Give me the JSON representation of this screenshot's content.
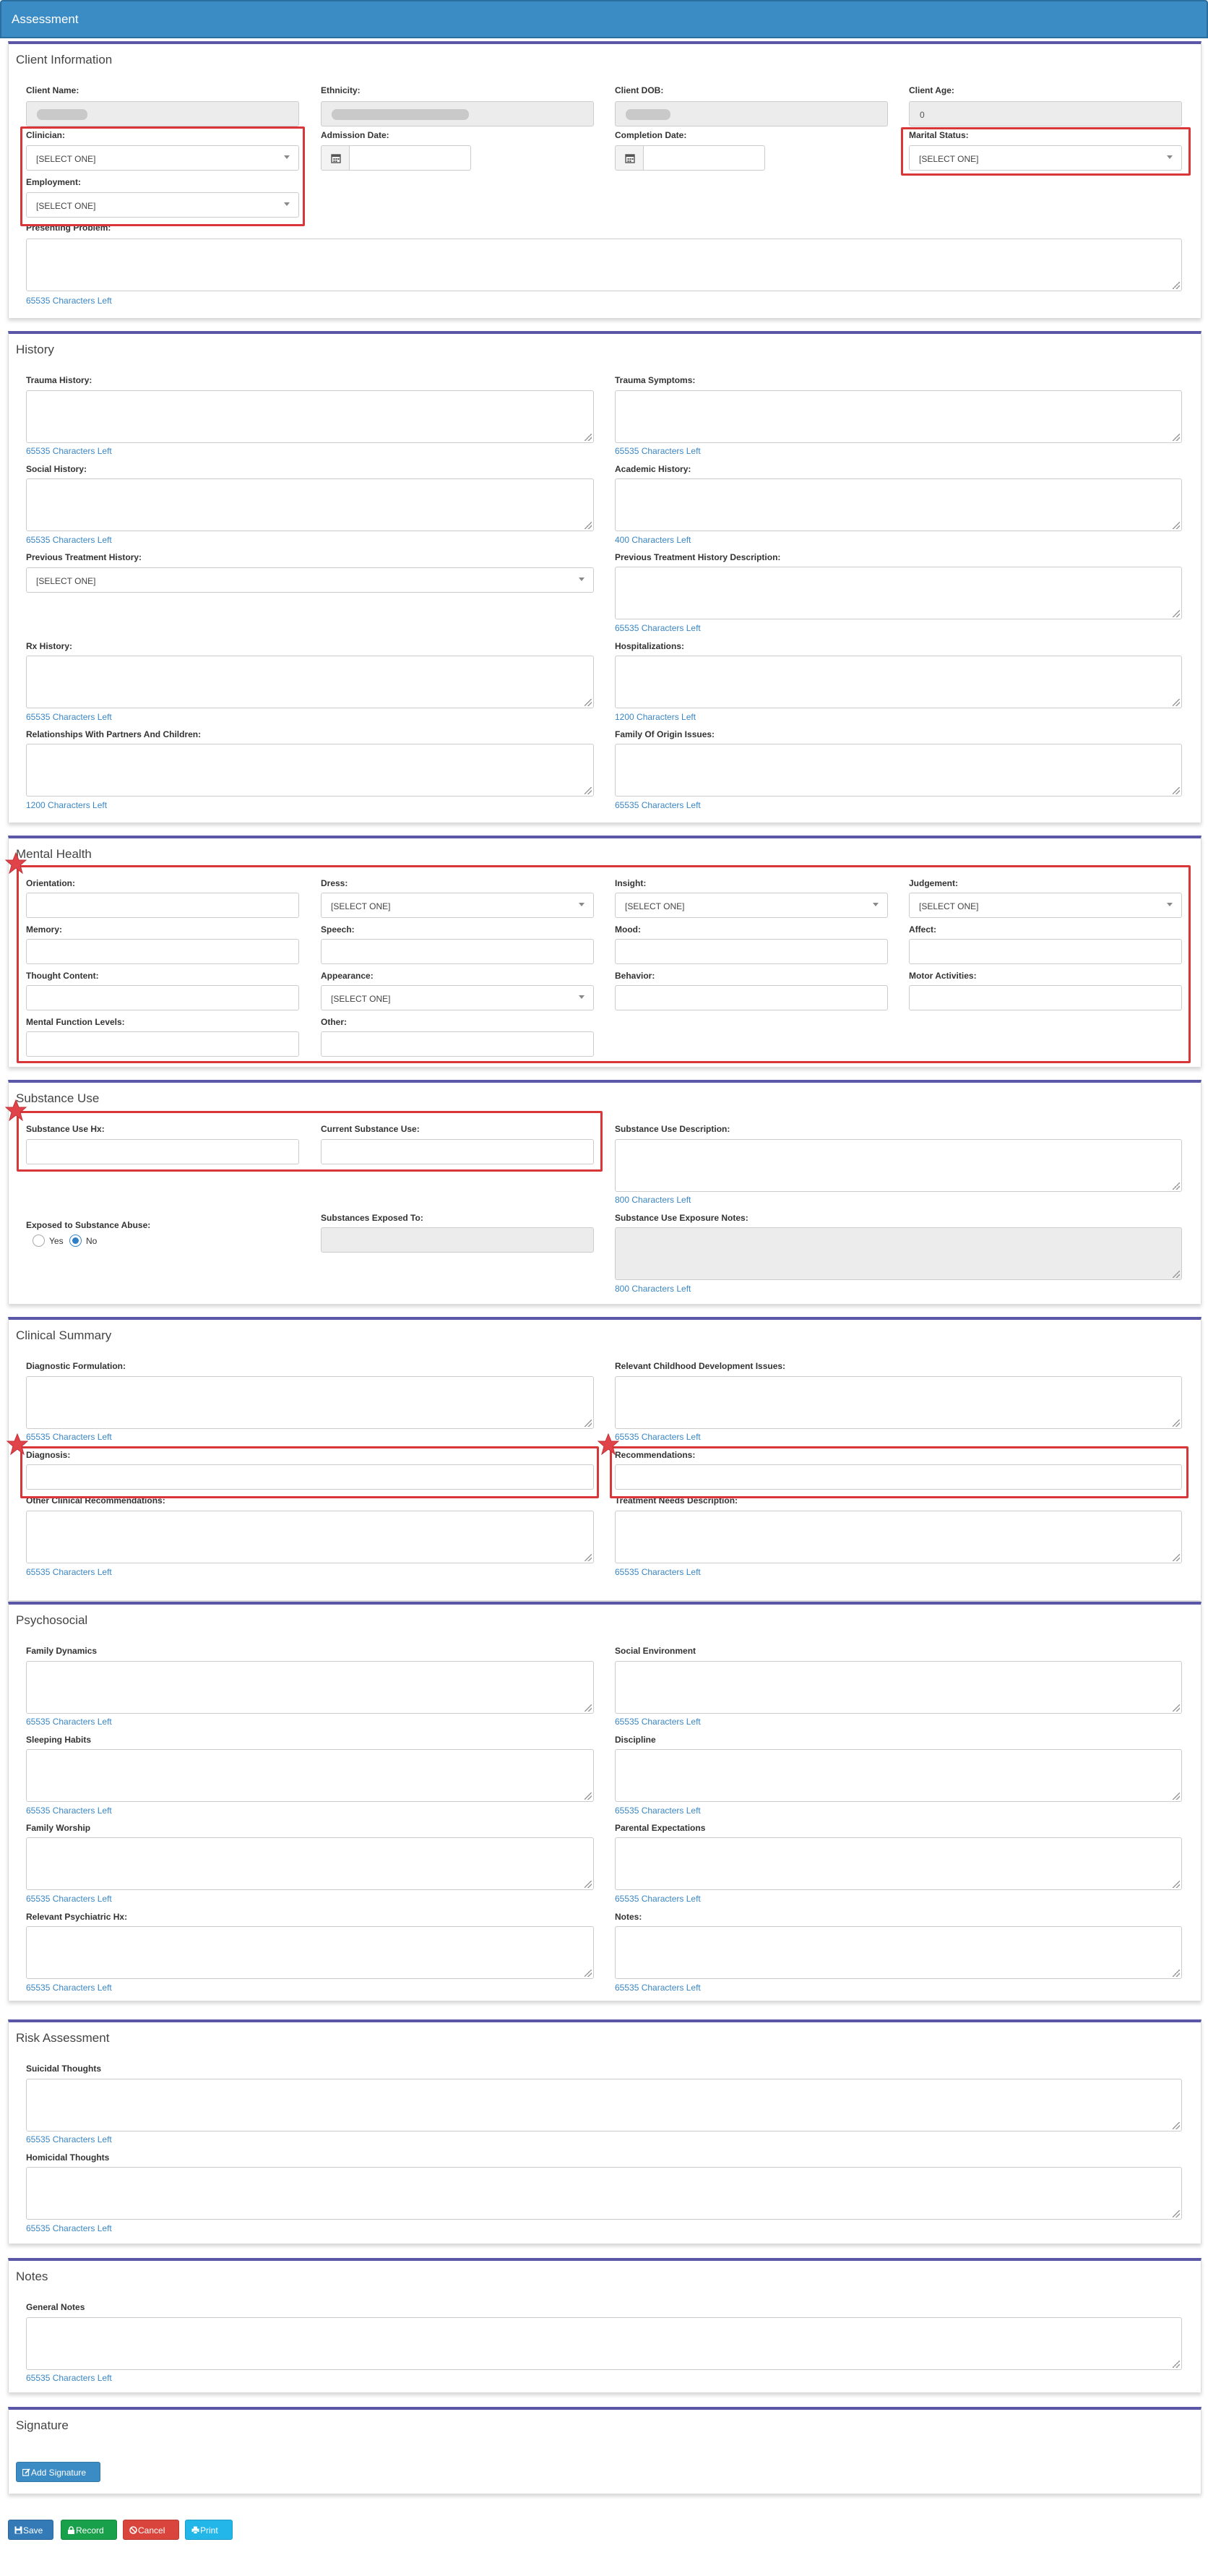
{
  "header": {
    "title": "Assessment"
  },
  "common": {
    "chars_65535": "65535 Characters Left",
    "chars_400": "400 Characters Left",
    "chars_1200": "1200 Characters Left",
    "chars_800": "800 Characters Left",
    "select_one": "[SELECT ONE]"
  },
  "client_info": {
    "title": "Client Information",
    "client_name": "Client Name:",
    "ethnicity": "Ethnicity:",
    "client_dob": "Client DOB:",
    "client_age": "Client Age:",
    "client_age_value": "0",
    "clinician": "Clinician:",
    "admission_date": "Admission Date:",
    "completion_date": "Completion Date:",
    "marital_status": "Marital Status:",
    "employment": "Employment:",
    "presenting_problem": "Presenting Problem:"
  },
  "history": {
    "title": "History",
    "trauma_history": "Trauma History:",
    "trauma_symptoms": "Trauma Symptoms:",
    "social_history": "Social History:",
    "academic_history": "Academic History:",
    "previous_treatment_history": "Previous Treatment History:",
    "previous_treatment_description": "Previous Treatment History Description:",
    "rx_history": "Rx History:",
    "hospitalizations": "Hospitalizations:",
    "relationships": "Relationships With Partners And Children:",
    "family_of_origin": "Family Of Origin Issues:"
  },
  "mental_health": {
    "title": "Mental Health",
    "orientation": "Orientation:",
    "dress": "Dress:",
    "insight": "Insight:",
    "judgement": "Judgement:",
    "memory": "Memory:",
    "speech": "Speech:",
    "mood": "Mood:",
    "affect": "Affect:",
    "thought_content": "Thought Content:",
    "appearance": "Appearance:",
    "behavior": "Behavior:",
    "motor_activities": "Motor Activities:",
    "mental_function_levels": "Mental Function Levels:",
    "other": "Other:"
  },
  "substance_use": {
    "title": "Substance Use",
    "substance_use_hx": "Substance Use Hx:",
    "current_substance_use": "Current Substance Use:",
    "substance_use_description": "Substance Use Description:",
    "exposed": "Exposed to Substance Abuse:",
    "yes": "Yes",
    "no": "No",
    "substances_exposed_to": "Substances Exposed To:",
    "exposure_notes": "Substance Use Exposure Notes:"
  },
  "clinical_summary": {
    "title": "Clinical Summary",
    "diagnostic_formulation": "Diagnostic Formulation:",
    "childhood_development": "Relevant Childhood Development Issues:",
    "diagnosis": "Diagnosis:",
    "recommendations": "Recommendations:",
    "other_clinical": "Other Clinical Recommendations:",
    "treatment_needs": "Treatment Needs Description:"
  },
  "psychosocial": {
    "title": "Psychosocial",
    "family_dynamics": "Family Dynamics",
    "social_environment": "Social Environment",
    "sleeping_habits": "Sleeping Habits",
    "discipline": "Discipline",
    "family_worship": "Family Worship",
    "parental_expectations": "Parental Expectations",
    "psychiatric_hx": "Relevant Psychiatric Hx:",
    "notes": "Notes:"
  },
  "risk": {
    "title": "Risk Assessment",
    "suicidal": "Suicidal Thoughts",
    "homicidal": "Homicidal Thoughts"
  },
  "notes": {
    "title": "Notes",
    "general": "General Notes"
  },
  "signature": {
    "title": "Signature",
    "add_signature": "Add Signature"
  },
  "actions": {
    "save": "Save",
    "record": "Record",
    "cancel": "Cancel",
    "print": "Print"
  },
  "colors": {
    "primary": "#3b8bc5",
    "section_border": "#5a57a6",
    "highlight": "#d9363a",
    "save": "#337ab7",
    "record": "#18a04a",
    "cancel": "#d9453c",
    "print": "#22b7e8"
  }
}
